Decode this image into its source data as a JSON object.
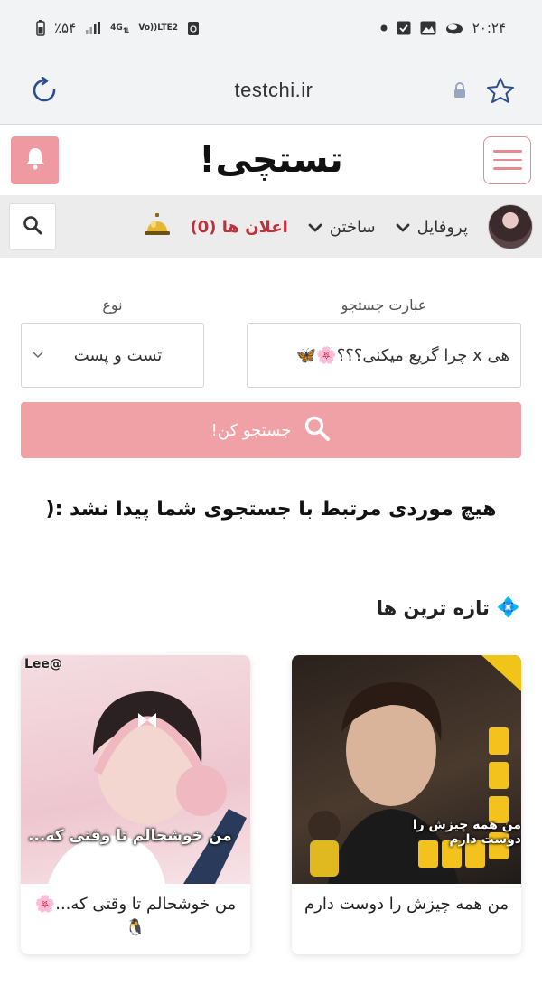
{
  "status_bar": {
    "battery": "٪۵۴",
    "net_4g": "4G",
    "volte": "Vo))",
    "lte": "LTE2",
    "time": "۲۰:۲۴"
  },
  "browser": {
    "url": "testchi.ir"
  },
  "site": {
    "logo": "تستچی!"
  },
  "nav": {
    "profile": "پروفایل",
    "create": "ساختن",
    "notifications": "اعلان ها (0)"
  },
  "search": {
    "query_label": "عبارت جستجو",
    "query_value": "هی x چرا گریع میکنی؟؟؟🌸🦋",
    "type_label": "نوع",
    "type_value": "تست و پست",
    "submit_label": "جستجو کن!"
  },
  "results": {
    "empty_message": "هیچ موردی مرتبط با جستجوی شما پیدا نشد :("
  },
  "fresh": {
    "title": "تازه ترین ها",
    "title_icon": "💠",
    "cards": [
      {
        "title": "من همه چیزش را دوست دارم",
        "caption": "من همه چیزش را دوست دارم",
        "bg": "#3a2a22"
      },
      {
        "title": "من خوشحالم تا وقتی که...🌸🐧",
        "caption": "من خوشحالم تا وقتی که...",
        "watermark": "@Lee",
        "bg": "#f1d3d8"
      }
    ]
  },
  "colors": {
    "accent": "#ef9aa0",
    "nav_bg": "#ececec",
    "notif": "#c0303b"
  }
}
